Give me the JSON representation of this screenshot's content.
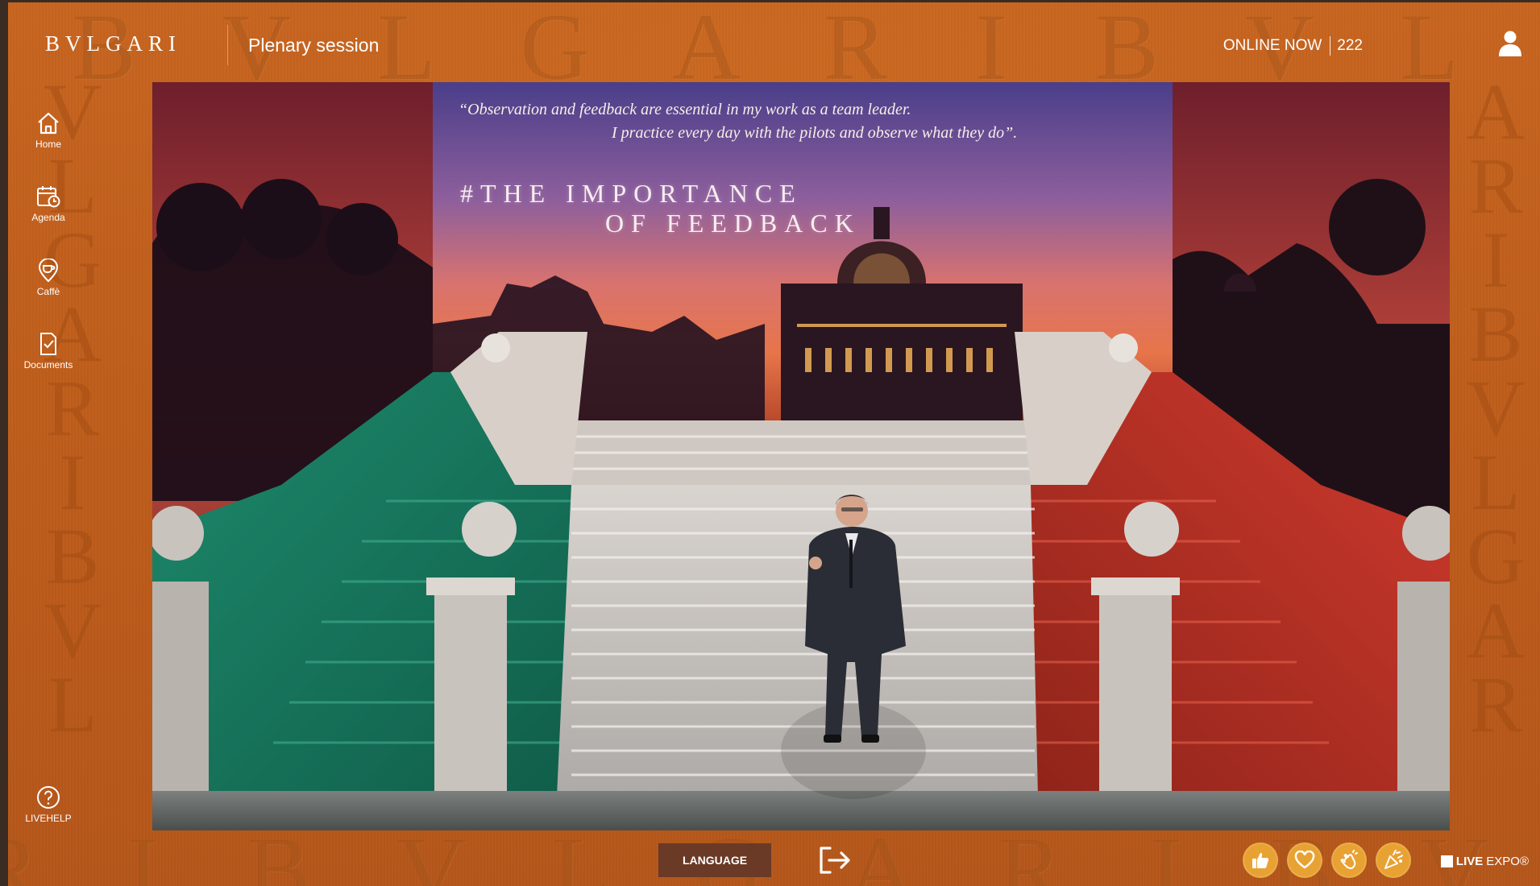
{
  "header": {
    "logo_text": "BVLGARI",
    "session_title": "Plenary session",
    "online_label": "ONLINE NOW",
    "online_count": "222"
  },
  "watermark": {
    "text": "BVLGARI"
  },
  "sidebar": {
    "items": [
      {
        "label": "Home",
        "icon": "home-icon"
      },
      {
        "label": "Agenda",
        "icon": "agenda-icon"
      },
      {
        "label": "Caffè",
        "icon": "cafe-icon"
      },
      {
        "label": "Documents",
        "icon": "documents-icon"
      }
    ],
    "help": {
      "label": "LIVEHELP",
      "icon": "help-icon"
    }
  },
  "video": {
    "quote_line1": "“Observation and feedback are essential in my work as a team leader.",
    "quote_line2": "I practice every day with the pilots and observe what they do”.",
    "headline_line1": "#THE IMPORTANCE",
    "headline_line2": "OF FEEDBACK"
  },
  "controls": {
    "language_label": "LANGUAGE",
    "exit_icon": "exit-icon",
    "reactions": [
      "thumbs-up-icon",
      "heart-icon",
      "clap-icon",
      "celebrate-icon"
    ]
  },
  "footer": {
    "brand_bold": "LIVE",
    "brand_rest": "EXPO®"
  },
  "colors": {
    "background": "#c3601d",
    "reaction": "#e8a233",
    "language_button": "#6a3a26"
  }
}
